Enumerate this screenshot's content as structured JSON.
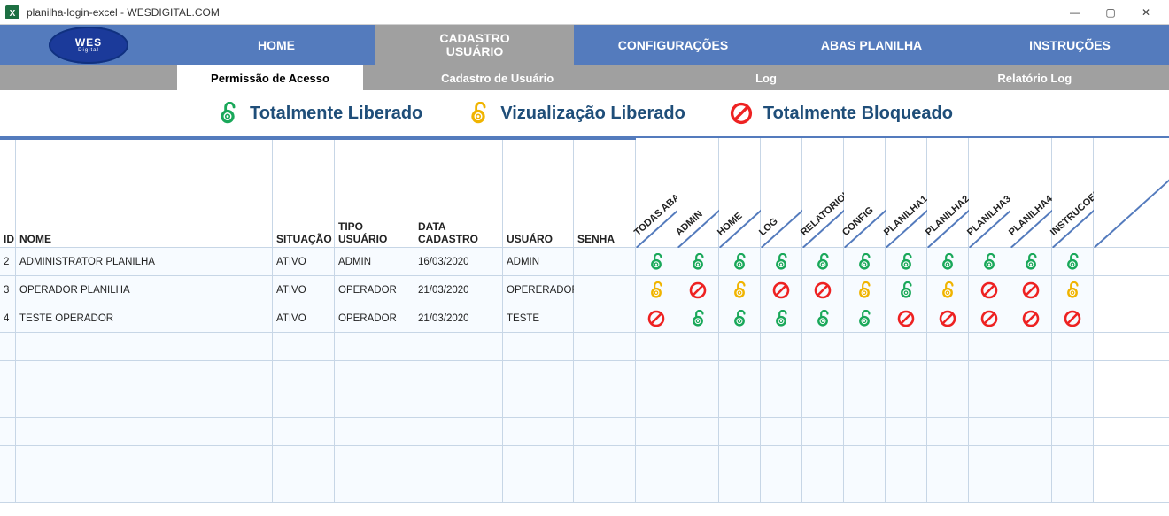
{
  "window": {
    "title": "planilha-login-excel - WESDIGITAL.COM"
  },
  "logo": {
    "main": "WES",
    "sub": "Digital"
  },
  "nav": {
    "items": [
      {
        "label": "HOME"
      },
      {
        "label": "CADASTRO USUÁRIO",
        "active": true
      },
      {
        "label": "CONFIGURAÇÕES"
      },
      {
        "label": "ABAS PLANILHA"
      },
      {
        "label": "INSTRUÇÕES"
      }
    ]
  },
  "subnav": {
    "items": [
      {
        "label": "Permissão de Acesso",
        "active": true
      },
      {
        "label": "Cadastro de Usuário"
      },
      {
        "label": "Log"
      },
      {
        "label": "Relatório Log"
      }
    ]
  },
  "legend": {
    "free": {
      "label": "Totalmente Liberado",
      "icon": "open"
    },
    "view": {
      "label": "Vizualização Liberado",
      "icon": "view"
    },
    "blocked": {
      "label": "Totalmente Bloqueado",
      "icon": "block"
    }
  },
  "columns": {
    "id": "ID",
    "nome": "NOME",
    "situacao": "SITUAÇÃO",
    "tipo": "TIPO USUÁRIO",
    "data": "DATA CADASTRO",
    "usuario": "USUÁRO",
    "senha": "SENHA",
    "perms": [
      "TODAS ABAS",
      "ADMIN",
      "HOME",
      "LOG",
      "RELATORIOLOG",
      "CONFIG",
      "PLANILHA1",
      "PLANILHA2",
      "PLANILHA3",
      "PLANILHA4",
      "INSTRUCOES"
    ]
  },
  "rows": [
    {
      "id": "2",
      "nome": "ADMINISTRATOR PLANILHA",
      "situacao": "ATIVO",
      "tipo": "ADMIN",
      "data": "16/03/2020",
      "usuario": "ADMIN",
      "senha": "",
      "perms": [
        "open",
        "open",
        "open",
        "open",
        "open",
        "open",
        "open",
        "open",
        "open",
        "open",
        "open"
      ]
    },
    {
      "id": "3",
      "nome": "OPERADOR PLANILHA",
      "situacao": "ATIVO",
      "tipo": "OPERADOR",
      "data": "21/03/2020",
      "usuario": "OPERERADOR",
      "senha": "",
      "perms": [
        "view",
        "block",
        "view",
        "block",
        "block",
        "view",
        "open",
        "view",
        "block",
        "block",
        "view"
      ]
    },
    {
      "id": "4",
      "nome": "TESTE OPERADOR",
      "situacao": "ATIVO",
      "tipo": "OPERADOR",
      "data": "21/03/2020",
      "usuario": "TESTE",
      "senha": "",
      "perms": [
        "block",
        "open",
        "open",
        "open",
        "open",
        "open",
        "block",
        "block",
        "block",
        "block",
        "block"
      ]
    }
  ],
  "empty_rows": 6
}
